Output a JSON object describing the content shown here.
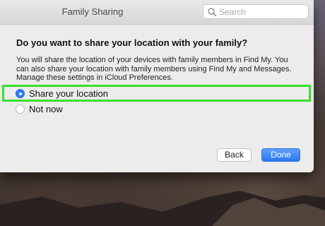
{
  "window": {
    "title": "Family Sharing",
    "search_placeholder": "Search"
  },
  "dialog": {
    "question": "Do you want to share your location with your family?",
    "description_lines": [
      "You will share the location of your devices with family members in Find My. You",
      "can also share your location with family members using Find My and Messages.",
      "Manage these settings in iCloud Preferences."
    ],
    "options": [
      {
        "label": "Share your location",
        "selected": true
      },
      {
        "label": "Not now",
        "selected": false
      }
    ],
    "buttons": {
      "back": "Back",
      "done": "Done"
    }
  },
  "colors": {
    "accent": "#2f7bf5",
    "highlight": "#38e02a"
  }
}
